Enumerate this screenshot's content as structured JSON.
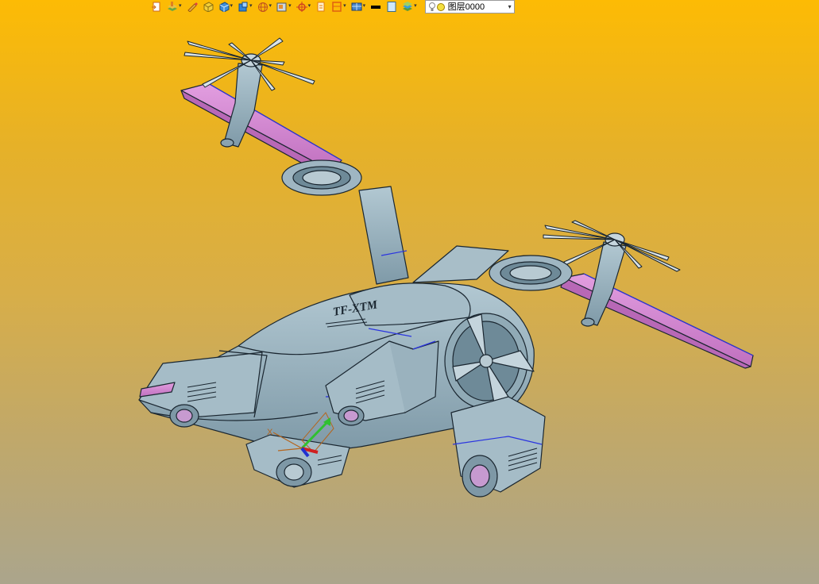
{
  "toolbar": {
    "items": [
      {
        "icon": "document-exit-icon",
        "has_dropdown": false
      },
      {
        "icon": "layer-style-icon",
        "has_dropdown": true
      },
      {
        "icon": "pencil-icon",
        "has_dropdown": false
      },
      {
        "icon": "solid-box-icon",
        "has_dropdown": false
      },
      {
        "icon": "cube-blue-icon",
        "has_dropdown": true
      },
      {
        "icon": "cube-cut-icon",
        "has_dropdown": true
      },
      {
        "icon": "sphere-wire-icon",
        "has_dropdown": true
      },
      {
        "icon": "view-box-icon",
        "has_dropdown": true
      },
      {
        "icon": "snap-target-icon",
        "has_dropdown": true
      },
      {
        "icon": "page-orange-icon",
        "has_dropdown": false
      },
      {
        "icon": "frame-orange-icon",
        "has_dropdown": true
      },
      {
        "icon": "display-grid-icon",
        "has_dropdown": true
      },
      {
        "icon": "line-color-icon",
        "has_dropdown": false
      },
      {
        "icon": "fill-color-icon",
        "has_dropdown": false
      },
      {
        "icon": "layers-stack-icon",
        "has_dropdown": true
      }
    ],
    "layer_selector": {
      "value": "图层0000"
    }
  },
  "colors": {
    "body": "#9bb6c4",
    "body_shade": "#7c9aaa",
    "wing": "#d98ad6",
    "wing_shade": "#c070bf",
    "edge": "#1a2630",
    "highlight": "#2a34e0"
  },
  "model": {
    "decal_text": "TF-XTM"
  }
}
